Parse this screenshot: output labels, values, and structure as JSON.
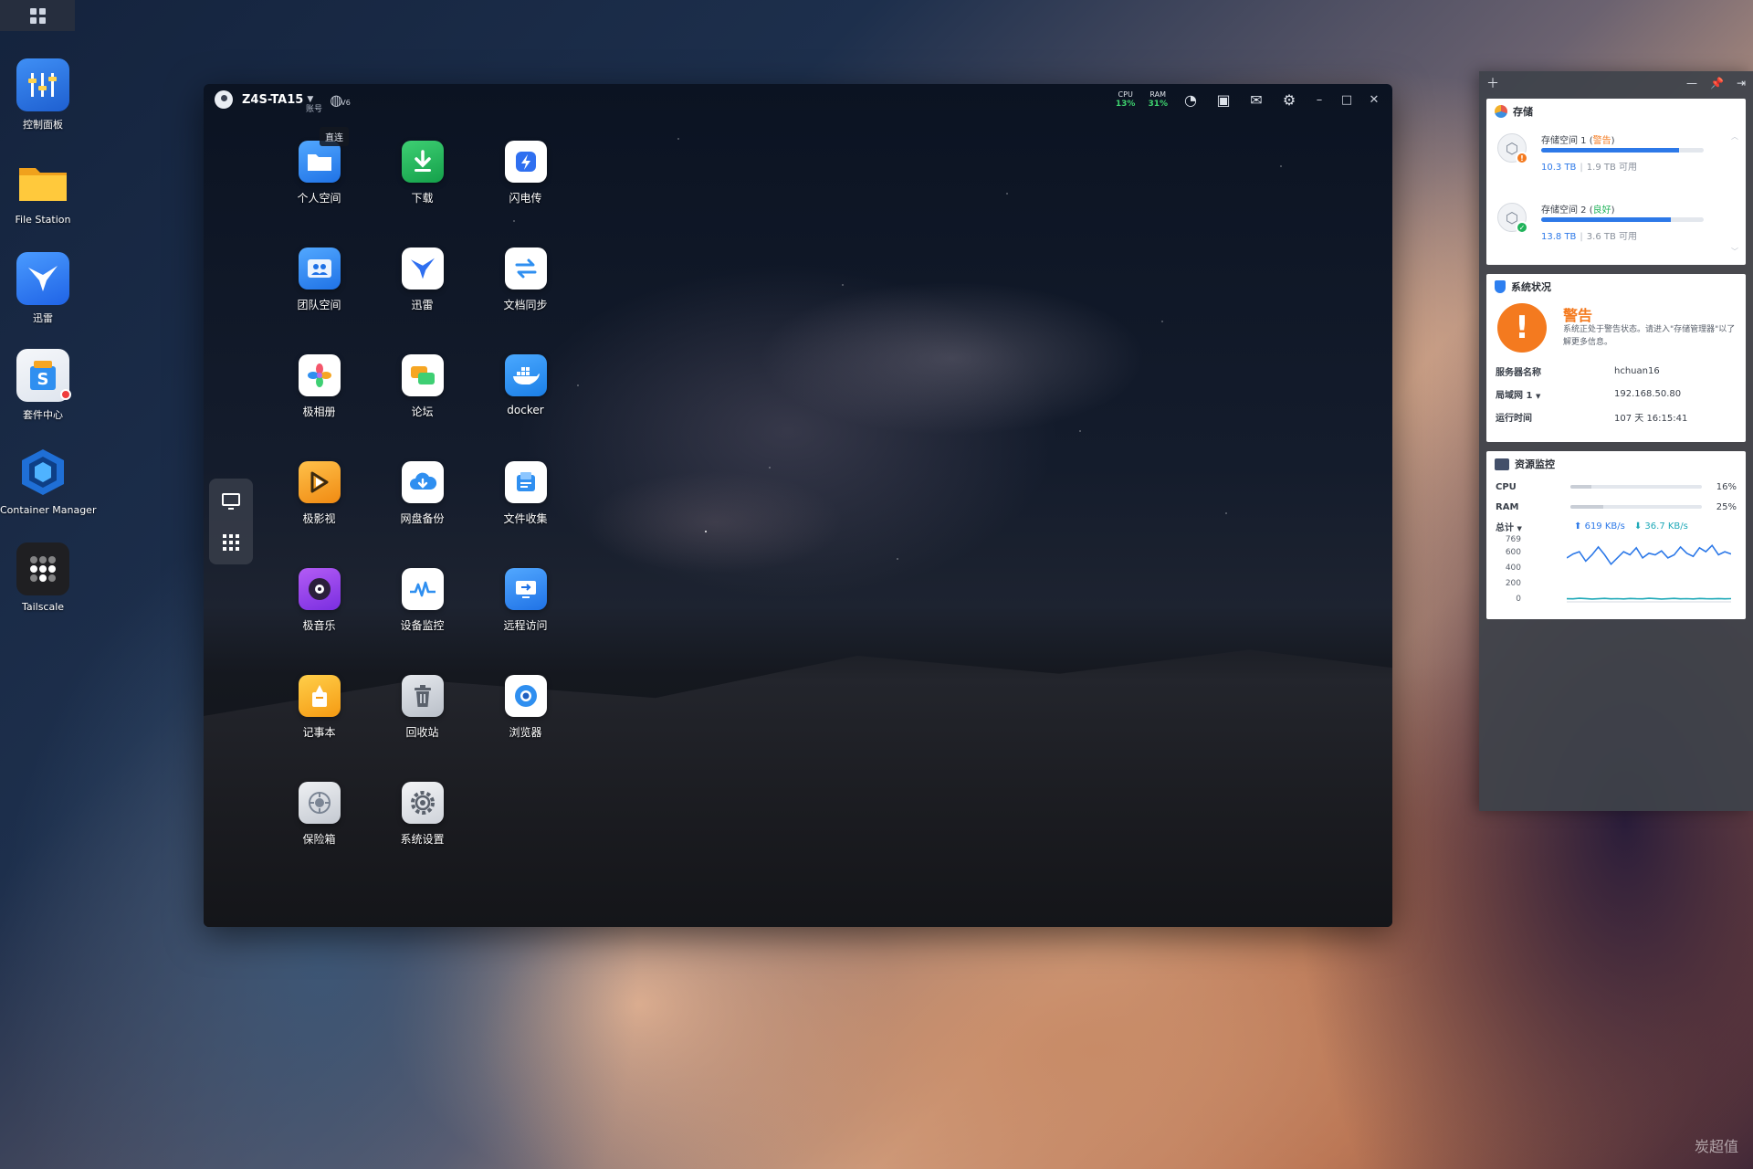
{
  "desktop": {
    "icons": [
      {
        "label": "控制面板",
        "icon": "control-panel-icon"
      },
      {
        "label": "File Station",
        "icon": "folder-icon"
      },
      {
        "label": "迅雷",
        "icon": "thunder-bird-icon"
      },
      {
        "label": "套件中心",
        "icon": "package-center-icon"
      },
      {
        "label": "Container Manager",
        "icon": "container-manager-icon"
      },
      {
        "label": "Tailscale",
        "icon": "tailscale-icon"
      }
    ]
  },
  "window": {
    "device_name": "Z4S-TA15",
    "network_mode": "V6",
    "tooltip_account": "账号",
    "tooltip_direct": "直连",
    "cpu_label": "CPU",
    "cpu_value": "13%",
    "ram_label": "RAM",
    "ram_value": "31%",
    "apps": [
      {
        "label": "个人空间",
        "icon": "personal-space-icon",
        "color": "#2f8ff0"
      },
      {
        "label": "下载",
        "icon": "download-icon",
        "color": "#20b35a"
      },
      {
        "label": "闪电传",
        "icon": "lightning-transfer-icon",
        "color": "#2f6ff0"
      },
      {
        "label": "团队空间",
        "icon": "team-space-icon",
        "color": "#2a8ff0"
      },
      {
        "label": "迅雷",
        "icon": "thunder-bird-icon",
        "color": "#ffffff"
      },
      {
        "label": "文档同步",
        "icon": "doc-sync-icon",
        "color": "#ffffff"
      },
      {
        "label": "极相册",
        "icon": "photo-album-icon",
        "color": "#ffffff"
      },
      {
        "label": "论坛",
        "icon": "forum-icon",
        "color": "#ffffff"
      },
      {
        "label": "docker",
        "icon": "docker-icon",
        "color": "#1f8ff0"
      },
      {
        "label": "极影视",
        "icon": "video-icon",
        "color": "#f6a623"
      },
      {
        "label": "网盘备份",
        "icon": "cloud-backup-icon",
        "color": "#ffffff"
      },
      {
        "label": "文件收集",
        "icon": "file-collect-icon",
        "color": "#ffffff"
      },
      {
        "label": "极音乐",
        "icon": "music-icon",
        "color": "#8b3fe0"
      },
      {
        "label": "设备监控",
        "icon": "device-monitor-icon",
        "color": "#ffffff"
      },
      {
        "label": "远程访问",
        "icon": "remote-access-icon",
        "color": "#2a8ff0"
      },
      {
        "label": "记事本",
        "icon": "notepad-icon",
        "color": "#ffb21e"
      },
      {
        "label": "回收站",
        "icon": "recycle-bin-icon",
        "color": "#c9ced6"
      },
      {
        "label": "浏览器",
        "icon": "browser-icon",
        "color": "#ffffff"
      },
      {
        "label": "保险箱",
        "icon": "safe-box-icon",
        "color": "#d0d5dc"
      },
      {
        "label": "系统设置",
        "icon": "settings-icon",
        "color": "#e4e7ec"
      }
    ]
  },
  "panel": {
    "storage": {
      "title": "存储",
      "volumes": [
        {
          "name": "存储空间 1",
          "status": "警告",
          "status_color": "#f47a1f",
          "used": "10.3 TB",
          "free": "1.9 TB 可用",
          "fill_fraction": 0.85
        },
        {
          "name": "存储空间 2",
          "status": "良好",
          "status_color": "#20b35a",
          "used": "13.8 TB",
          "free": "3.6 TB 可用",
          "fill_fraction": 0.8
        }
      ]
    },
    "system": {
      "title": "系统状况",
      "warning_title": "警告",
      "warning_desc": "系统正处于警告状态。请进入\"存储管理器\"以了解更多信息。",
      "server_name_label": "服务器名称",
      "server_name": "hchuan16",
      "lan_label": "局域网 1",
      "lan_ip": "192.168.50.80",
      "uptime_label": "运行时间",
      "uptime": "107 天 16:15:41"
    },
    "resource": {
      "title": "资源监控",
      "cpu_label": "CPU",
      "cpu_value": "16%",
      "cpu_fraction": 0.16,
      "ram_label": "RAM",
      "ram_value": "25%",
      "ram_fraction": 0.25,
      "total_label": "总计",
      "upload": "619 KB/s",
      "download": "36.7 KB/s",
      "y_ticks": [
        "769",
        "600",
        "400",
        "200",
        "0"
      ],
      "upload_series": [
        560,
        610,
        640,
        520,
        600,
        700,
        600,
        480,
        560,
        640,
        600,
        690,
        560,
        620,
        600,
        650,
        560,
        600,
        700,
        620,
        580,
        690,
        640,
        720,
        600,
        640,
        610
      ],
      "download_series": [
        40,
        38,
        45,
        42,
        36,
        40,
        44,
        39,
        41,
        37,
        43,
        40,
        38,
        45,
        42,
        36,
        40,
        44,
        39,
        41,
        37,
        43,
        40,
        38,
        42,
        39,
        41
      ]
    }
  },
  "watermark": "炭超值"
}
